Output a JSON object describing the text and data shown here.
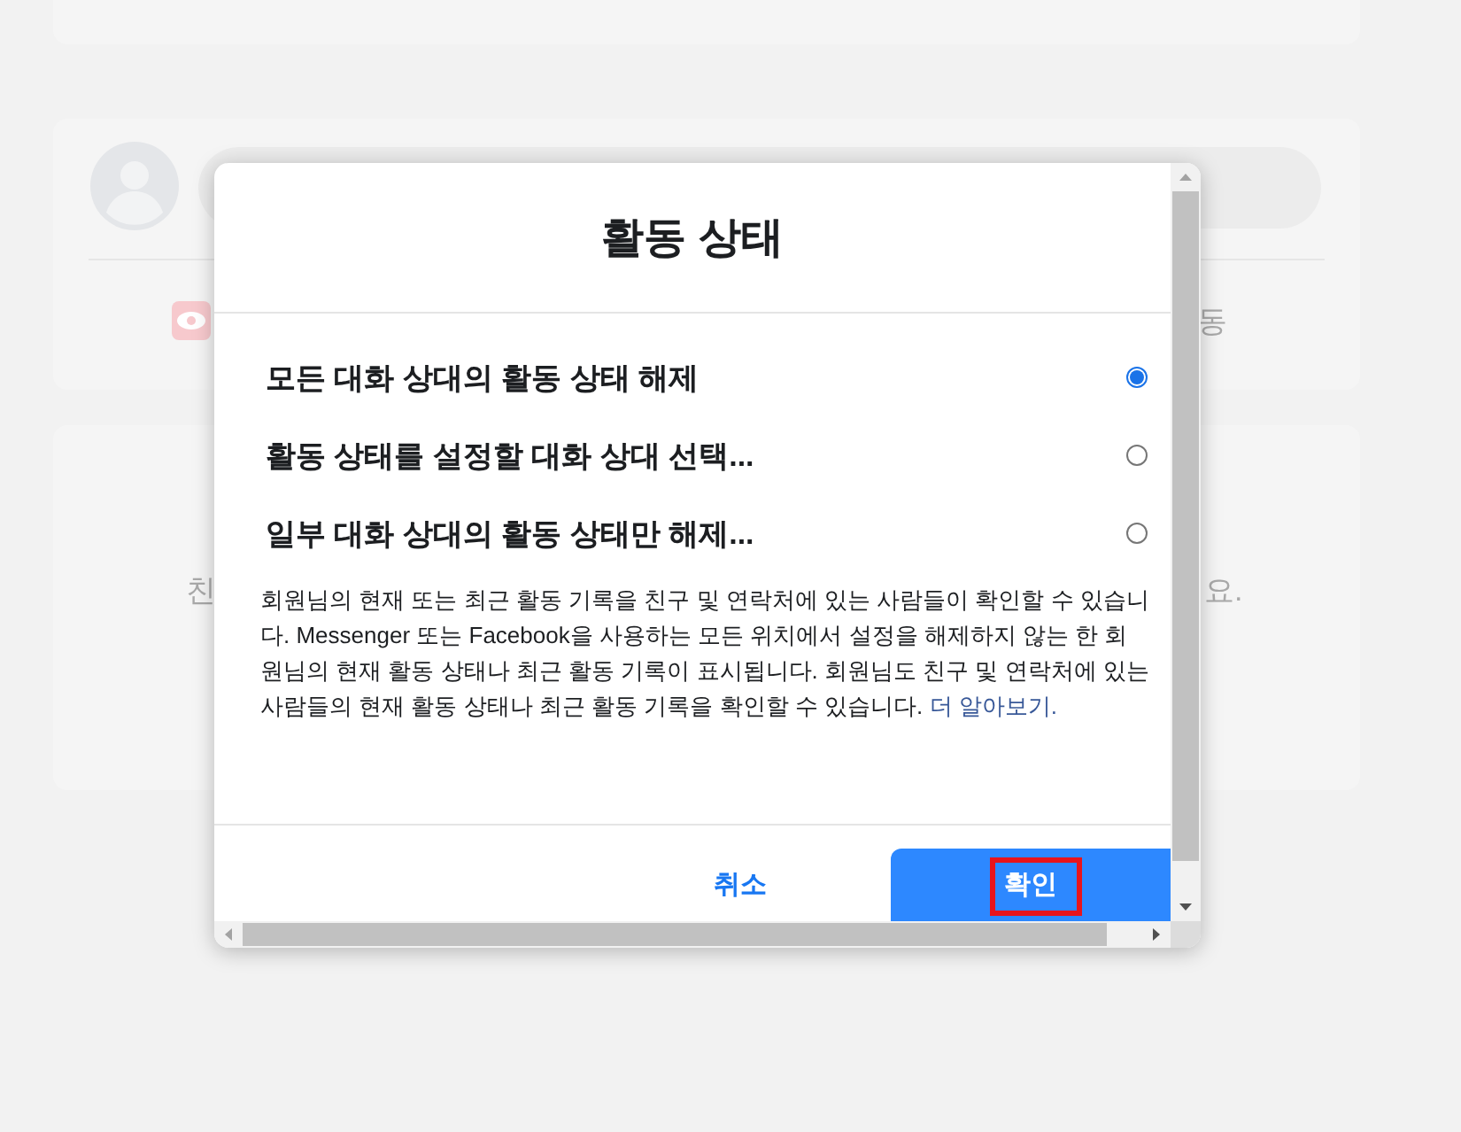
{
  "background": {
    "card_fragments": [
      {
        "text": "동"
      },
      {
        "text": "친"
      },
      {
        "text": "요."
      }
    ]
  },
  "dialog": {
    "title": "활동 상태",
    "options": [
      {
        "label": "모든 대화 상대의 활동 상태 해제",
        "selected": true
      },
      {
        "label": "활동 상태를 설정할 대화 상대 선택...",
        "selected": false
      },
      {
        "label": "일부 대화 상대의 활동 상태만 해제...",
        "selected": false
      }
    ],
    "description": "회원님의 현재 또는 최근 활동 기록을 친구 및 연락처에 있는 사람들이 확인할 수 있습니다. Messenger 또는 Facebook을 사용하는 모든 위치에서 설정을 해제하지 않는 한 회원님의 현재 활동 상태나 최근 활동 기록이 표시됩니다. 회원님도 친구 및 연락처에 있는 사람들의 현재 활동 상태나 최근 활동 기록을 확인할 수 있습니다.",
    "link": "더 알아보기.",
    "cancel": "취소",
    "confirm": "확인",
    "confirm_highlighted": true
  }
}
